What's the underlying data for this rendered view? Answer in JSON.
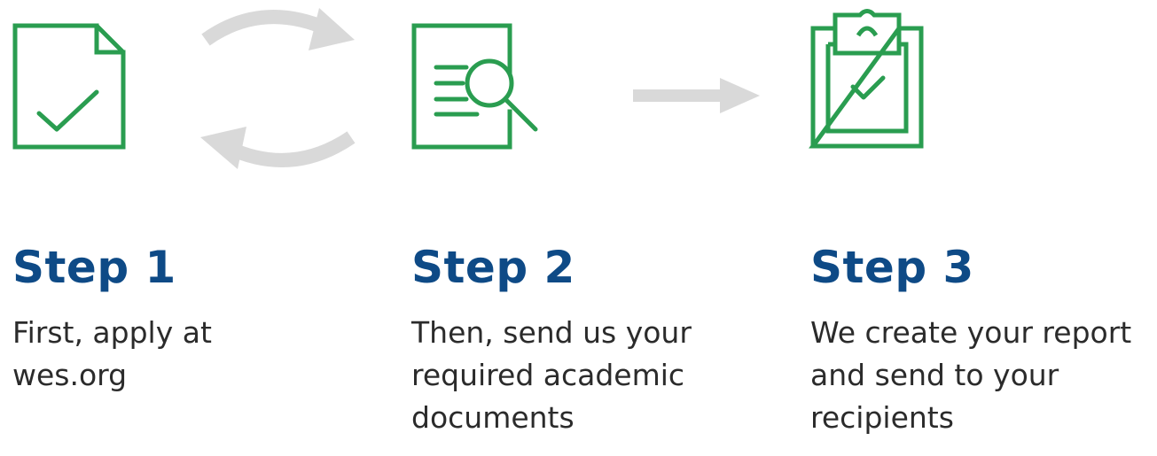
{
  "colors": {
    "icon_green": "#2a9d50",
    "title_blue": "#0e4a86",
    "connector_gray": "#d9d9d9",
    "text": "#2b2b2b"
  },
  "icons": [
    {
      "name": "document-check-icon"
    },
    {
      "name": "document-search-icon"
    },
    {
      "name": "clipboard-check-icon"
    }
  ],
  "connectors": [
    {
      "name": "cycle-arrows-icon"
    },
    {
      "name": "right-arrow-icon"
    }
  ],
  "steps": [
    {
      "title": "Step 1",
      "description": "First, apply at\nwes.org"
    },
    {
      "title": "Step 2",
      "description": "Then, send us your\nrequired academic\ndocuments"
    },
    {
      "title": "Step 3",
      "description": "We create your report\nand send to your\nrecipients"
    }
  ]
}
